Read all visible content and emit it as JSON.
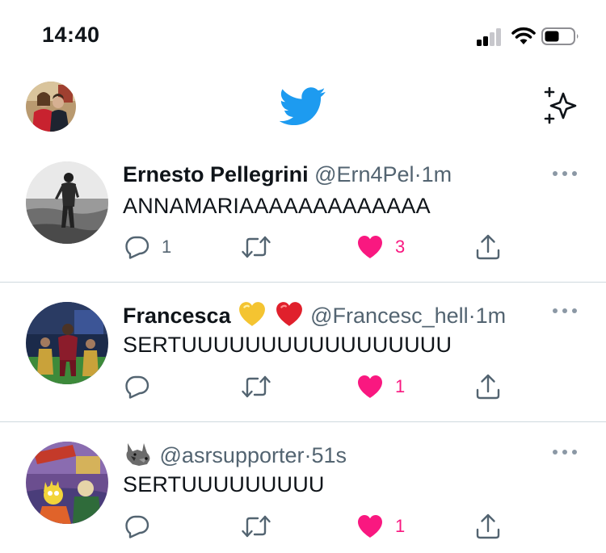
{
  "status_bar": {
    "time": "14:40"
  },
  "tweets": [
    {
      "name": "Ernesto Pellegrini",
      "handle": "@Ern4Pel",
      "separator": "·",
      "time": "1m",
      "text": "ANNAMARIAAAAAAAAAAAAA",
      "replies": "1",
      "likes": "3"
    },
    {
      "name": "Francesca",
      "handle": "@Francesc_hell",
      "separator": "·",
      "time": "1m",
      "text": "SERTUUUUUUUUUUUUUUUUU",
      "replies": "",
      "likes": "1"
    },
    {
      "name": "",
      "handle": "@asrsupporter",
      "separator": "·",
      "time": "51s",
      "text": "SERTUUUUUUUUU",
      "replies": "",
      "likes": "1"
    }
  ],
  "icons": {
    "status": [
      "signal-icon",
      "wifi-icon",
      "battery-icon"
    ],
    "header": [
      "profile-avatar",
      "twitter-logo-icon",
      "sparkle-icon"
    ],
    "actions": [
      "reply-icon",
      "retweet-icon",
      "heart-icon",
      "share-icon"
    ],
    "emojis": [
      "yellow-heart-emoji",
      "red-heart-emoji",
      "wolf-emoji"
    ]
  },
  "colors": {
    "brand_blue": "#1d9bf0",
    "like_pink": "#f91880",
    "secondary_text": "#536471",
    "divider": "#cfd9de"
  }
}
